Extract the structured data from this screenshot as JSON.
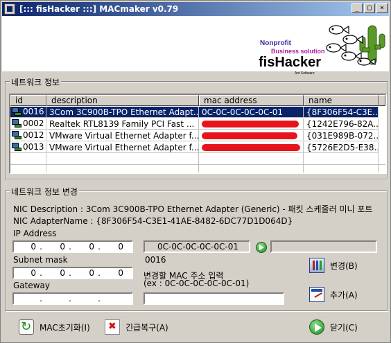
{
  "window": {
    "title": "[::: fisHacker :::] MACmaker v0.79",
    "minimize_glyph": "_",
    "maximize_glyph": "□",
    "close_glyph": "×"
  },
  "banner": {
    "line1": "Nonprofit",
    "line2": "Business solution",
    "logo_text": "fisHacker",
    "small_text": "Ant Software"
  },
  "network_info": {
    "label": "네트워크 정보",
    "columns": [
      "id",
      "description",
      "mac address",
      "name"
    ],
    "rows": [
      {
        "id": "0016",
        "description": "3Com 3C900B-TPO Ethernet Adapt...",
        "mac": "0C-0C-0C-0C-0C-01",
        "name": "{8F306F54-C3E...",
        "selected": true,
        "mac_redacted": false
      },
      {
        "id": "0002",
        "description": "Realtek RTL8139 Family PCI Fast ...",
        "mac": "",
        "name": "{1242E796-82A...",
        "selected": false,
        "mac_redacted": true
      },
      {
        "id": "0012",
        "description": "VMware Virtual Ethernet Adapter f...",
        "mac": "",
        "name": "{031E989B-072...",
        "selected": false,
        "mac_redacted": true
      },
      {
        "id": "0013",
        "description": "VMware Virtual Ethernet Adapter f...",
        "mac": "",
        "name": "{5726E2D5-E38...",
        "selected": false,
        "mac_redacted": true
      }
    ]
  },
  "network_change": {
    "label": "네트워크 정보 변경",
    "nic_description": "NIC Description : 3Com 3C900B-TPO Ethernet Adapter (Generic) - 패킷 스케줄러 미니 포트",
    "nic_adapter_name": "NIC AdapterName : {8F306F54-C3E1-41AE-8482-6DC77D1D064D}",
    "ip_label": "IP Address",
    "ip_octets": [
      "0",
      "0",
      "0",
      "0"
    ],
    "current_mac": "0C-0C-0C-0C-0C-01",
    "target_mac": "",
    "subnet_label": "Subnet mask",
    "subnet_octets": [
      "0",
      "0",
      "0",
      "0"
    ],
    "device_id": "0016",
    "mac_input_label": "변경할 MAC 주소 입력",
    "mac_input_example": "(ex : 0C-0C-0C-0C-0C-01)",
    "gateway_label": "Gateway",
    "gateway_octets": [
      "",
      "",
      "",
      ""
    ],
    "new_mac_value": "",
    "change_button": "변경(B)",
    "add_button": "추가(A)"
  },
  "bottom": {
    "reset_button": "MAC초기화(I)",
    "restore_button": "긴급복구(A)",
    "close_button": "닫기(C)"
  },
  "colors": {
    "titlebar": "#0a246a",
    "selection": "#0a246a",
    "redaction": "#e8141c",
    "dialog_bg": "#d4d0c8"
  }
}
